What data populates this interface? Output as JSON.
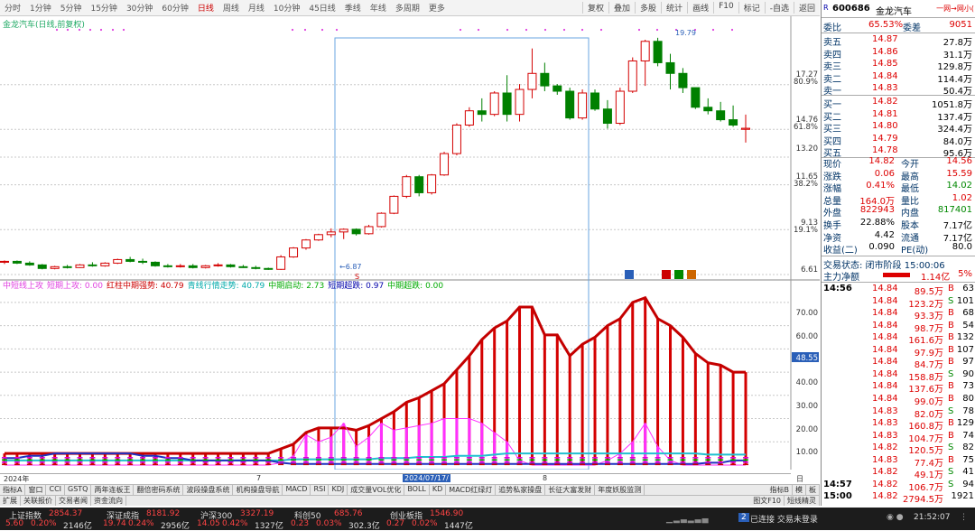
{
  "toolbar": {
    "periods": [
      "分时",
      "1分钟",
      "5分钟",
      "15分钟",
      "30分钟",
      "60分钟",
      "日线",
      "周线",
      "月线",
      "10分钟",
      "45日线",
      "季线",
      "年线",
      "多周期",
      "更多"
    ],
    "active": "日线",
    "tools": [
      "复权",
      "叠加",
      "多股",
      "统计",
      "画线",
      "F10",
      "标记",
      "-自选",
      "返回"
    ]
  },
  "chart_title": "金龙汽车(日线,前复权)",
  "price_axis": [
    "17.27",
    "80.9%",
    "14.76",
    "61.8%",
    "13.20",
    "11.65",
    "38.2%",
    "9.13",
    "19.1%",
    "6.61"
  ],
  "annotations": {
    "low": "6.87",
    "high": "19.79"
  },
  "indicator": {
    "name": "中短线上攻",
    "fields": [
      {
        "t": "短期上攻: 0.00",
        "c": "#e040e0"
      },
      {
        "t": "红柱中期强势: 40.79",
        "c": "#c00"
      },
      {
        "t": "青线行情走势: 40.79",
        "c": "#0aa"
      },
      {
        "t": "中期启动: 2.73",
        "c": "#0a0"
      },
      {
        "t": "短期超跌: 0.97",
        "c": "#00a"
      },
      {
        "t": "中期超跌: 0.00",
        "c": "#0a0"
      }
    ]
  },
  "ind_axis": [
    "70.00",
    "60.00",
    "48.55",
    "40.00",
    "30.00",
    "20.00",
    "10.00"
  ],
  "dates": {
    "year": "2024年",
    "m7": "7",
    "sel": "2024/07/17/",
    "m8": "8",
    "right": "日线"
  },
  "tabs1": [
    "指标A",
    "窗口",
    "CCI",
    "GSTQ",
    "两年连板王",
    "翻倍密码系统",
    "波段操盘系统",
    "机构操盘导航",
    "MACD",
    "RSI",
    "KDJ",
    "成交量VOL优化",
    "BOLL",
    "KD",
    "MACD红绿灯",
    "追势私家操盘",
    "长征大富发财",
    "年度妖股监测",
    "指标B",
    "模",
    "板"
  ],
  "tabs2": [
    "扩展",
    "关联报价",
    "交易者闻",
    "资金流向"
  ],
  "tabs2_right": [
    "图文F10",
    "短线精灵"
  ],
  "quote": {
    "code": "600686",
    "name": "金龙汽车",
    "tag": "R",
    "sub": "一网→网小(",
    "weibi": {
      "label": "委比",
      "val": "65.53%",
      "label2": "委差",
      "val2": "9051"
    },
    "sell": [
      {
        "l": "卖五",
        "p": "14.87",
        "v": "27.8万"
      },
      {
        "l": "卖四",
        "p": "14.86",
        "v": "31.1万"
      },
      {
        "l": "卖三",
        "p": "14.85",
        "v": "129.8万"
      },
      {
        "l": "卖二",
        "p": "14.84",
        "v": "114.4万"
      },
      {
        "l": "卖一",
        "p": "14.83",
        "v": "50.4万"
      }
    ],
    "buy": [
      {
        "l": "买一",
        "p": "14.82",
        "v": "1051.8万"
      },
      {
        "l": "买二",
        "p": "14.81",
        "v": "137.4万"
      },
      {
        "l": "买三",
        "p": "14.80",
        "v": "324.4万"
      },
      {
        "l": "买四",
        "p": "14.79",
        "v": "84.0万"
      },
      {
        "l": "买五",
        "p": "14.78",
        "v": "95.6万"
      }
    ],
    "stats": [
      [
        "现价",
        "14.82",
        "今开",
        "14.56"
      ],
      [
        "涨跌",
        "0.06",
        "最高",
        "15.59"
      ],
      [
        "涨幅",
        "0.41%",
        "最低",
        "14.02"
      ],
      [
        "总量",
        "164.0万",
        "量比",
        "1.02"
      ],
      [
        "外盘",
        "822943",
        "内盘",
        "817401"
      ],
      [
        "换手",
        "22.88%",
        "股本",
        "7.17亿"
      ],
      [
        "净资",
        "4.42",
        "流通",
        "7.17亿"
      ],
      [
        "收益(二)",
        "0.090",
        "PE(动)",
        "80.0"
      ]
    ],
    "state": "交易状态: 闭市阶段 15:00:06",
    "flow": {
      "label": "主力净额",
      "val": "1.14亿",
      "pct": "5%"
    },
    "ticks": [
      [
        "14:56",
        "14.84",
        "89.5万",
        "B",
        "63"
      ],
      [
        "",
        "14.84",
        "123.2万",
        "S",
        "101"
      ],
      [
        "",
        "14.84",
        "93.3万",
        "B",
        "68"
      ],
      [
        "",
        "14.84",
        "98.7万",
        "B",
        "54"
      ],
      [
        "",
        "14.84",
        "161.6万",
        "B",
        "132"
      ],
      [
        "",
        "14.84",
        "97.9万",
        "B",
        "107"
      ],
      [
        "",
        "14.84",
        "84.7万",
        "B",
        "97"
      ],
      [
        "",
        "14.84",
        "158.8万",
        "S",
        "90"
      ],
      [
        "",
        "14.84",
        "137.6万",
        "B",
        "73"
      ],
      [
        "",
        "14.84",
        "99.0万",
        "B",
        "80"
      ],
      [
        "",
        "14.83",
        "82.0万",
        "S",
        "78"
      ],
      [
        "",
        "14.83",
        "160.8万",
        "B",
        "129"
      ],
      [
        "",
        "14.83",
        "104.7万",
        "B",
        "74"
      ],
      [
        "",
        "14.82",
        "120.5万",
        "S",
        "82"
      ],
      [
        "",
        "14.83",
        "77.4万",
        "B",
        "75"
      ],
      [
        "",
        "14.82",
        "49.1万",
        "S",
        "41"
      ],
      [
        "14:57",
        "14.82",
        "106.7万",
        "S",
        "94"
      ],
      [
        "15:00",
        "14.82",
        "2794.5万",
        "",
        "1921"
      ]
    ]
  },
  "status": {
    "items": [
      {
        "n": "上证指数",
        "v": "2854.37",
        "c": "5.60",
        "p": "0.20%",
        "a": "2146亿"
      },
      {
        "n": "深证成指",
        "v": "8181.92",
        "c": "19.74",
        "p": "0.24%",
        "a": "2956亿"
      },
      {
        "n": "沪深300",
        "v": "3327.19",
        "c": "14.05",
        "p": "0.42%",
        "a": "1327亿"
      },
      {
        "n": "科创50",
        "v": "685.76",
        "c": "0.23",
        "p": "0.03%",
        "a": "302.3亿"
      },
      {
        "n": "创业板指",
        "v": "1546.90",
        "c": "0.27",
        "p": "0.02%",
        "a": "1447亿"
      }
    ],
    "conn": "已连接 交易未登录",
    "conn_num": "2",
    "time": "21:52:07"
  },
  "chart_data": {
    "type": "candlestick",
    "ylim": [
      6.61,
      19.79
    ],
    "candles": [
      [
        7.3,
        7.4,
        7.2,
        7.35
      ],
      [
        7.35,
        7.4,
        7.2,
        7.25
      ],
      [
        7.25,
        7.35,
        7.1,
        7.15
      ],
      [
        7.15,
        7.2,
        6.9,
        6.95
      ],
      [
        6.95,
        7.1,
        6.9,
        7.05
      ],
      [
        7.05,
        7.15,
        6.95,
        7.0
      ],
      [
        7.0,
        7.2,
        6.98,
        7.15
      ],
      [
        7.15,
        7.3,
        7.05,
        7.1
      ],
      [
        7.1,
        7.3,
        7.05,
        7.25
      ],
      [
        7.25,
        7.5,
        7.2,
        7.45
      ],
      [
        7.45,
        7.6,
        7.3,
        7.35
      ],
      [
        7.35,
        7.5,
        7.2,
        7.3
      ],
      [
        7.3,
        7.35,
        7.05,
        7.1
      ],
      [
        7.1,
        7.2,
        7.0,
        7.05
      ],
      [
        7.05,
        7.2,
        7.0,
        7.1
      ],
      [
        7.1,
        7.2,
        6.95,
        7.0
      ],
      [
        7.0,
        7.15,
        6.95,
        7.1
      ],
      [
        7.1,
        7.25,
        7.05,
        7.15
      ],
      [
        7.15,
        7.2,
        7.0,
        7.05
      ],
      [
        7.05,
        7.15,
        6.98,
        7.0
      ],
      [
        7.0,
        7.1,
        6.9,
        6.95
      ],
      [
        6.95,
        7.0,
        6.87,
        6.9
      ],
      [
        6.9,
        7.7,
        6.87,
        7.6
      ],
      [
        7.6,
        8.15,
        7.55,
        8.1
      ],
      [
        8.1,
        8.6,
        8.0,
        8.55
      ],
      [
        8.55,
        8.9,
        8.5,
        8.85
      ],
      [
        8.85,
        9.2,
        8.7,
        9.0
      ],
      [
        9.0,
        9.2,
        8.6,
        9.15
      ],
      [
        9.15,
        9.2,
        8.8,
        8.9
      ],
      [
        8.9,
        9.4,
        8.85,
        9.3
      ],
      [
        9.3,
        10.1,
        9.25,
        10.05
      ],
      [
        10.05,
        11.05,
        10.0,
        11.0
      ],
      [
        11.0,
        12.2,
        10.9,
        12.1
      ],
      [
        12.1,
        12.2,
        11.0,
        11.2
      ],
      [
        11.2,
        12.25,
        11.1,
        12.2
      ],
      [
        12.2,
        13.5,
        12.15,
        13.4
      ],
      [
        13.4,
        15.1,
        13.3,
        15.0
      ],
      [
        15.0,
        16.0,
        14.9,
        15.8
      ],
      [
        15.8,
        16.5,
        15.2,
        15.6
      ],
      [
        15.6,
        16.9,
        15.5,
        16.8
      ],
      [
        16.8,
        17.8,
        15.2,
        15.6
      ],
      [
        15.6,
        17.3,
        15.2,
        17.0
      ],
      [
        17.0,
        19.3,
        16.5,
        17.9
      ],
      [
        17.9,
        18.5,
        16.9,
        17.2
      ],
      [
        17.2,
        17.3,
        16.7,
        16.9
      ],
      [
        16.9,
        17.1,
        15.3,
        15.4
      ],
      [
        15.4,
        17.0,
        15.3,
        16.8
      ],
      [
        16.8,
        17.0,
        15.8,
        15.9
      ],
      [
        15.9,
        16.4,
        14.8,
        15.1
      ],
      [
        15.1,
        17.1,
        15.0,
        16.9
      ],
      [
        16.9,
        18.8,
        16.8,
        18.6
      ],
      [
        18.6,
        19.79,
        17.2,
        19.7
      ],
      [
        19.7,
        19.9,
        18.3,
        18.5
      ],
      [
        18.5,
        19.0,
        17.0,
        17.9
      ],
      [
        17.9,
        18.2,
        16.8,
        17.1
      ],
      [
        17.1,
        17.1,
        15.9,
        16.0
      ],
      [
        16.0,
        16.5,
        15.6,
        15.8
      ],
      [
        15.8,
        16.3,
        15.2,
        15.3
      ],
      [
        15.3,
        16.1,
        14.9,
        15.0
      ],
      [
        14.76,
        15.59,
        14.02,
        14.82
      ]
    ],
    "ind_red": [
      5,
      5,
      5,
      5,
      5,
      5,
      5,
      5,
      5,
      5,
      5,
      5,
      5,
      5,
      5,
      5,
      5,
      5,
      5,
      5,
      5,
      5,
      7,
      9,
      14,
      16,
      16,
      16,
      15,
      17,
      20,
      23,
      27,
      29,
      32,
      35,
      41,
      47,
      54,
      59,
      62,
      68,
      68,
      56,
      56,
      47,
      52,
      55,
      60,
      63,
      70,
      72,
      63,
      60,
      55,
      48,
      44,
      43,
      40,
      40
    ],
    "ind_magenta": [
      0,
      0,
      0,
      0,
      0,
      0,
      0,
      0,
      0,
      0,
      0,
      0,
      0,
      0,
      0,
      0,
      0,
      0,
      0,
      0,
      0,
      0,
      1,
      4,
      13,
      10,
      12,
      18,
      8,
      12,
      18,
      15,
      16,
      17,
      18,
      20,
      20,
      20,
      18,
      14,
      10,
      2,
      0,
      0,
      0,
      0,
      0,
      0,
      2,
      5,
      10,
      18,
      8,
      2,
      0,
      0,
      0,
      0,
      0,
      0
    ],
    "ind_cyan": [
      2,
      2,
      2,
      2,
      2,
      2,
      2,
      2,
      2,
      2,
      2,
      2,
      2,
      2,
      2,
      2,
      2,
      2,
      2,
      2,
      2,
      2,
      2,
      2.5,
      2.5,
      2.5,
      2.5,
      2.5,
      2.5,
      2.5,
      3,
      3,
      3,
      3.5,
      3.5,
      3.5,
      4,
      4,
      4,
      4.5,
      5,
      5,
      5,
      5,
      5,
      5,
      5,
      5,
      5,
      5,
      5,
      5,
      5,
      5,
      5,
      5,
      4.5,
      4.5,
      4.5,
      4.5
    ],
    "ind_blue": [
      3,
      3,
      4,
      4,
      5,
      5,
      5,
      5,
      5,
      5,
      5,
      4,
      4,
      3,
      3,
      2,
      2,
      2,
      2,
      2,
      2,
      2,
      1,
      0.5,
      0.5,
      0.5,
      0.5,
      0.5,
      0.5,
      0.5,
      0.5,
      0.5,
      0.5,
      0.5,
      0.5,
      0.5,
      0.5,
      0.5,
      0.5,
      0.5,
      0.5,
      0.5,
      0.5,
      0.5,
      0.5,
      0.5,
      0.5,
      0.5,
      0.5,
      0.5,
      0.5,
      0.5,
      0.5,
      0.5,
      0.5,
      0.5,
      1,
      1,
      2,
      2
    ]
  }
}
